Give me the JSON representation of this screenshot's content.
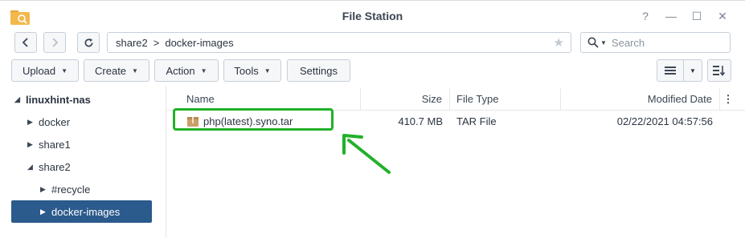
{
  "window": {
    "title": "File Station",
    "controls": {
      "help": "?",
      "minimize": "—",
      "maximize": "☐",
      "close": "✕"
    }
  },
  "navigation": {
    "back_icon": "chevron-left-icon",
    "forward_icon": "chevron-right-icon",
    "refresh_icon": "refresh-icon",
    "path": [
      "share2",
      "docker-images"
    ],
    "path_separator": ">",
    "search_placeholder": "Search"
  },
  "toolbar": {
    "upload": "Upload",
    "create": "Create",
    "action": "Action",
    "tools": "Tools",
    "settings": "Settings"
  },
  "sidebar": {
    "root": "linuxhint-nas",
    "items": [
      {
        "label": "docker",
        "level": 1,
        "expanded": false
      },
      {
        "label": "share1",
        "level": 1,
        "expanded": false
      },
      {
        "label": "share2",
        "level": 1,
        "expanded": true
      },
      {
        "label": "#recycle",
        "level": 2,
        "expanded": false
      },
      {
        "label": "docker-images",
        "level": 2,
        "expanded": false,
        "selected": true
      }
    ]
  },
  "file_list": {
    "columns": {
      "name": "Name",
      "size": "Size",
      "type": "File Type",
      "modified": "Modified Date"
    },
    "rows": [
      {
        "name": "php(latest).syno.tar",
        "size": "410.7 MB",
        "type": "TAR File",
        "modified": "02/22/2021 04:57:56"
      }
    ]
  },
  "colors": {
    "selected_bg": "#2b5a8c",
    "highlight": "#22b02a",
    "folder_icon": "#f0b429"
  }
}
